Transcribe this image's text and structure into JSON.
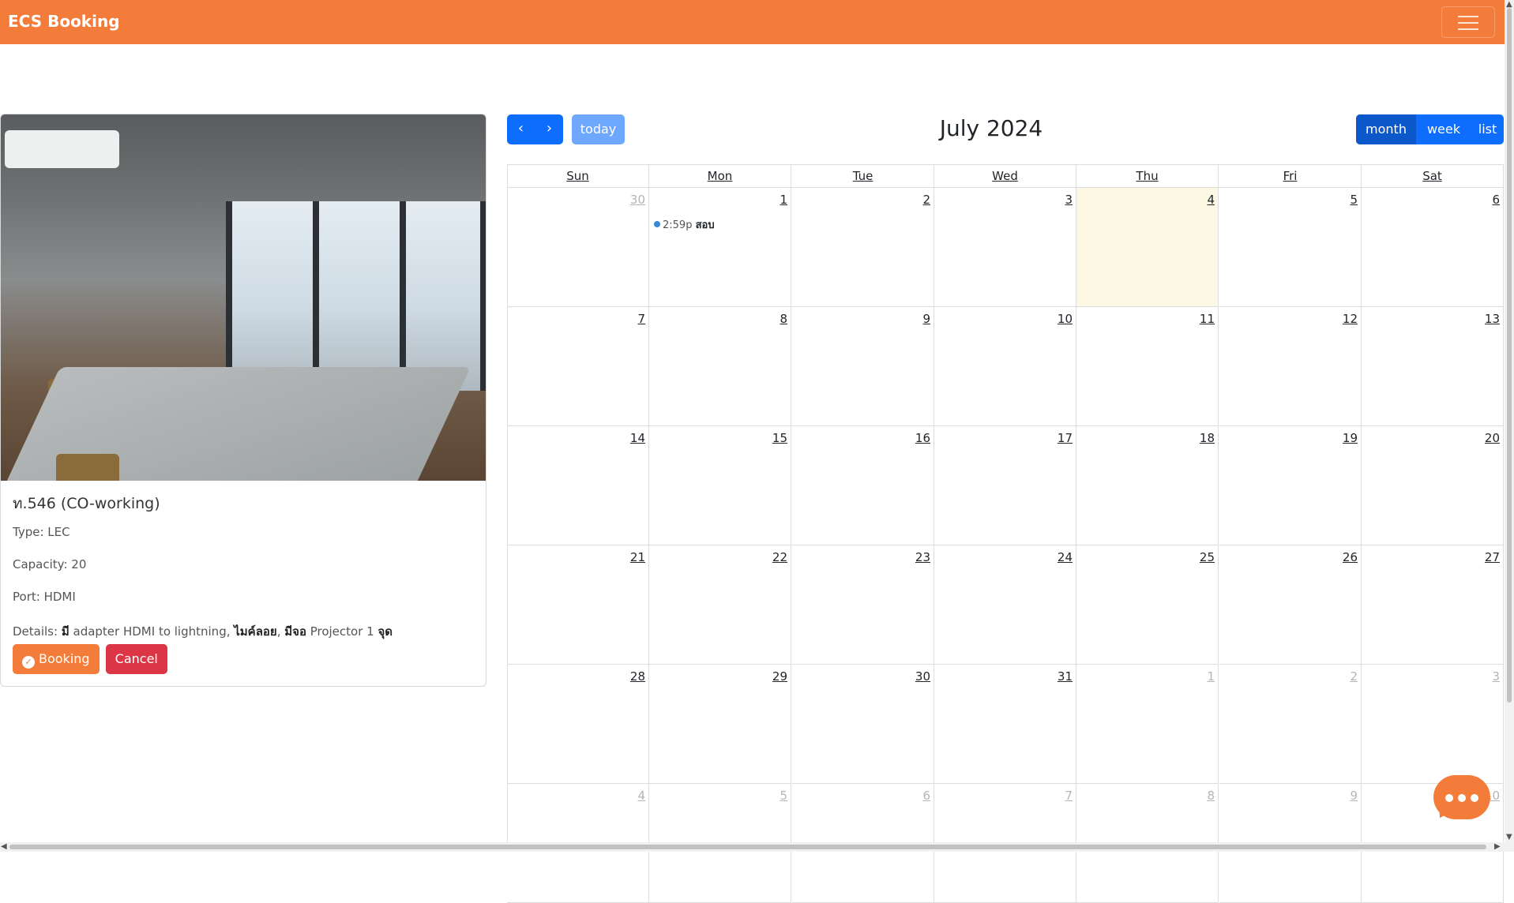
{
  "app": {
    "brand": "ECS Booking",
    "menu_icon": "hamburger-icon"
  },
  "room": {
    "title": "ท.546 (CO-working)",
    "type_label": "Type:",
    "type_value": "LEC",
    "capacity_label": "Capacity:",
    "capacity_value": "20",
    "port_label": "Port:",
    "port_value": "HDMI",
    "details_label": "Details:",
    "details_p1": "มี",
    "details_p2": " adapter HDMI to lightning, ",
    "details_p3": "ไมค์ลอย",
    "details_p4": ", ",
    "details_p5": "มีจอ",
    "details_p6": " Projector 1 ",
    "details_p7": "จุด"
  },
  "actions": {
    "booking_label": "Booking",
    "cancel_label": "Cancel"
  },
  "calendar": {
    "title": "July 2024",
    "prev": "‹",
    "next": "›",
    "today_label": "today",
    "views": [
      {
        "label": "month",
        "active": true
      },
      {
        "label": "week",
        "active": false
      },
      {
        "label": "list",
        "active": false
      }
    ],
    "weekdays": [
      "Sun",
      "Mon",
      "Tue",
      "Wed",
      "Thu",
      "Fri",
      "Sat"
    ],
    "weeks": [
      [
        {
          "d": "30",
          "other": true
        },
        {
          "d": "1"
        },
        {
          "d": "2"
        },
        {
          "d": "3"
        },
        {
          "d": "4",
          "today": true
        },
        {
          "d": "5"
        },
        {
          "d": "6"
        }
      ],
      [
        {
          "d": "7"
        },
        {
          "d": "8"
        },
        {
          "d": "9"
        },
        {
          "d": "10"
        },
        {
          "d": "11"
        },
        {
          "d": "12"
        },
        {
          "d": "13"
        }
      ],
      [
        {
          "d": "14"
        },
        {
          "d": "15"
        },
        {
          "d": "16"
        },
        {
          "d": "17"
        },
        {
          "d": "18"
        },
        {
          "d": "19"
        },
        {
          "d": "20"
        }
      ],
      [
        {
          "d": "21"
        },
        {
          "d": "22"
        },
        {
          "d": "23"
        },
        {
          "d": "24"
        },
        {
          "d": "25"
        },
        {
          "d": "26"
        },
        {
          "d": "27"
        }
      ],
      [
        {
          "d": "28"
        },
        {
          "d": "29"
        },
        {
          "d": "30"
        },
        {
          "d": "31"
        },
        {
          "d": "1",
          "other": true
        },
        {
          "d": "2",
          "other": true
        },
        {
          "d": "3",
          "other": true
        }
      ],
      [
        {
          "d": "4",
          "other": true
        },
        {
          "d": "5",
          "other": true
        },
        {
          "d": "6",
          "other": true
        },
        {
          "d": "7",
          "other": true
        },
        {
          "d": "8",
          "other": true
        },
        {
          "d": "9",
          "other": true
        },
        {
          "d": "10",
          "other": true
        }
      ]
    ],
    "events": [
      {
        "week": 0,
        "day": 1,
        "time": "2:59p",
        "name": "สอบ",
        "color": "#3788d8"
      }
    ]
  },
  "chat": {
    "icon": "chat-bubble-icon"
  },
  "colors": {
    "brand": "#f47c3a",
    "primary": "#0d6efd",
    "danger": "#dc3545",
    "today_bg": "#fcf8e3"
  }
}
